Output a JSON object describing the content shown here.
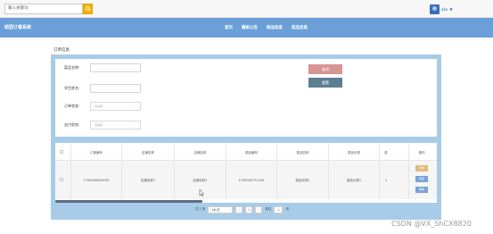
{
  "header": {
    "search_placeholder": "输入关键词",
    "user_name": "abo",
    "user_chevron": "▼"
  },
  "nav": {
    "logo": "校园订餐系统",
    "items": [
      "首页",
      "最新公告",
      "商品信息",
      "菜品信息"
    ]
  },
  "page": {
    "section_title": "订单信息"
  },
  "form": {
    "dish_name_label": "菜品名称:",
    "student_name_label": "学生姓名:",
    "order_status_label": "订单状态:",
    "order_status_placeholder": "请选择",
    "pay_status_label": "支付状态:",
    "pay_status_placeholder": "请选择",
    "query_button": "查询",
    "reset_button": "重置"
  },
  "table": {
    "headers": [
      "订单编号",
      "店铺名称",
      "店铺名称",
      "菜品编号",
      "菜品名称",
      "菜品分类",
      "菜",
      "操作"
    ],
    "row": [
      "1700000000100",
      "店铺名称1",
      "店铺名称1",
      "1700000711104",
      "菜品名称1",
      "菜品分类1",
      "1"
    ],
    "actions": [
      "详情",
      "修改",
      "删除"
    ]
  },
  "pagination": {
    "total": "共 1 条",
    "page_size": "5条/页",
    "prev": "<",
    "current": "1",
    "next": ">",
    "goto_label": "前往",
    "goto_value": "1",
    "page_unit": "页"
  },
  "watermark": "CSDN @VX_ShCX8820"
}
